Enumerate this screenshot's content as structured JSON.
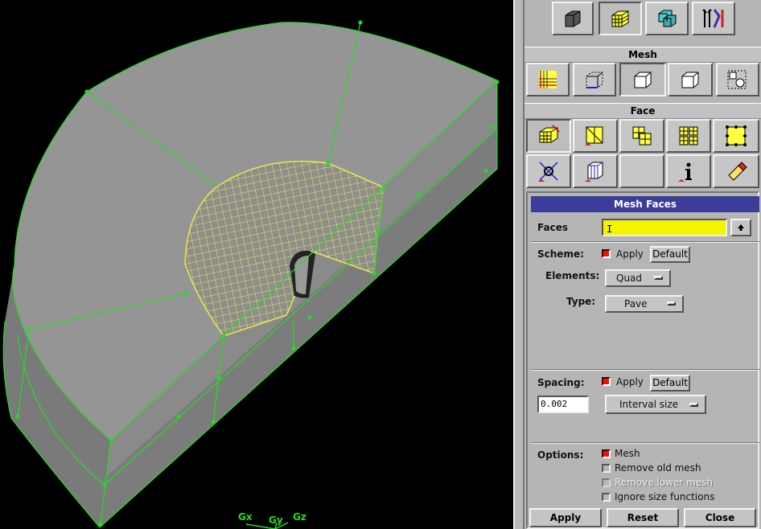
{
  "viewport": {
    "axes": {
      "x": "Gx",
      "y": "Gy",
      "z": "Gz"
    },
    "mesh_color": "#e8e84a",
    "edge_color": "#22dd22",
    "body_color": "#8e8e8e"
  },
  "toolbar_top": [
    {
      "icon": "geometry-icon"
    },
    {
      "icon": "mesh-icon"
    },
    {
      "icon": "zones-icon"
    },
    {
      "icon": "tools-icon"
    }
  ],
  "mesh_section": {
    "title": "Mesh"
  },
  "mesh_toolbar": [
    {
      "icon": "boundary-layer-icon"
    },
    {
      "icon": "edge-mesh-icon"
    },
    {
      "icon": "face-mesh-icon"
    },
    {
      "icon": "volume-mesh-icon"
    },
    {
      "icon": "group-mesh-icon"
    }
  ],
  "face_section": {
    "title": "Face"
  },
  "face_toolbar_row1": [
    {
      "icon": "mesh-faces-icon"
    },
    {
      "icon": "link-faces-icon"
    },
    {
      "icon": "smooth-faces-icon"
    },
    {
      "icon": "split-faces-icon"
    },
    {
      "icon": "modify-nodes-icon"
    }
  ],
  "face_toolbar_row2": [
    {
      "icon": "check-quality-icon"
    },
    {
      "icon": "summarize-icon"
    },
    {
      "icon": "blank-icon"
    },
    {
      "icon": "info-icon"
    },
    {
      "icon": "delete-mesh-icon"
    }
  ],
  "form": {
    "title": "Mesh Faces",
    "faces_label": "Faces",
    "faces_value": "",
    "scheme_label": "Scheme:",
    "scheme_apply": "Apply",
    "scheme_default": "Default",
    "elements_label": "Elements:",
    "elements_value": "Quad",
    "type_label": "Type:",
    "type_value": "Pave",
    "spacing_label": "Spacing:",
    "spacing_apply": "Apply",
    "spacing_default": "Default",
    "spacing_value": "0.002",
    "spacing_type": "Interval size",
    "options_label": "Options:",
    "opt_mesh": "Mesh",
    "opt_remove_old": "Remove old mesh",
    "opt_remove_lower": "Remove lower mesh",
    "opt_ignore_size": "Ignore size functions",
    "apply_button": "Apply",
    "reset_button": "Reset",
    "close_button": "Close"
  }
}
